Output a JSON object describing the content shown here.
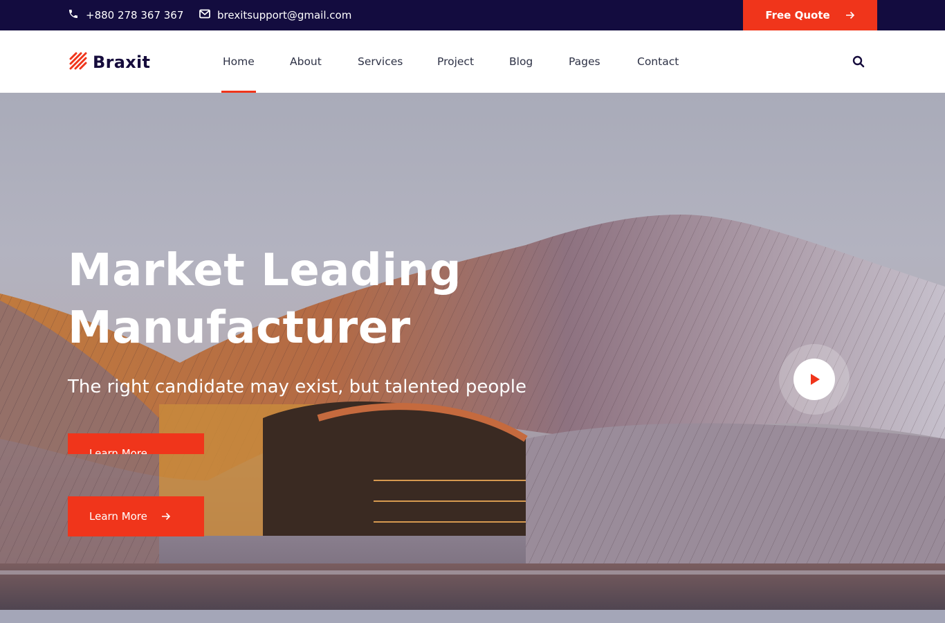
{
  "topbar": {
    "phone": "+880 278 367 367",
    "email": "brexitsupport@gmail.com",
    "quote_label": "Free Quote",
    "phone_icon": "phone-icon",
    "email_icon": "envelope-icon"
  },
  "brand": {
    "name": "Braxit",
    "logo_icon": "striped-logo-icon"
  },
  "nav": {
    "items": [
      {
        "label": "Home",
        "active": true
      },
      {
        "label": "About"
      },
      {
        "label": "Services"
      },
      {
        "label": "Project"
      },
      {
        "label": "Blog"
      },
      {
        "label": "Pages"
      },
      {
        "label": "Contact"
      }
    ],
    "search_icon": "search-icon"
  },
  "hero": {
    "title_line1": "Market Leading",
    "title_line2": "Manufacturer",
    "subtitle": "The right candidate may exist, but talented people",
    "cta_label": "Learn More",
    "play_icon": "play-icon"
  },
  "colors": {
    "accent": "#f0351b",
    "navy": "#130c3f",
    "white": "#ffffff"
  }
}
